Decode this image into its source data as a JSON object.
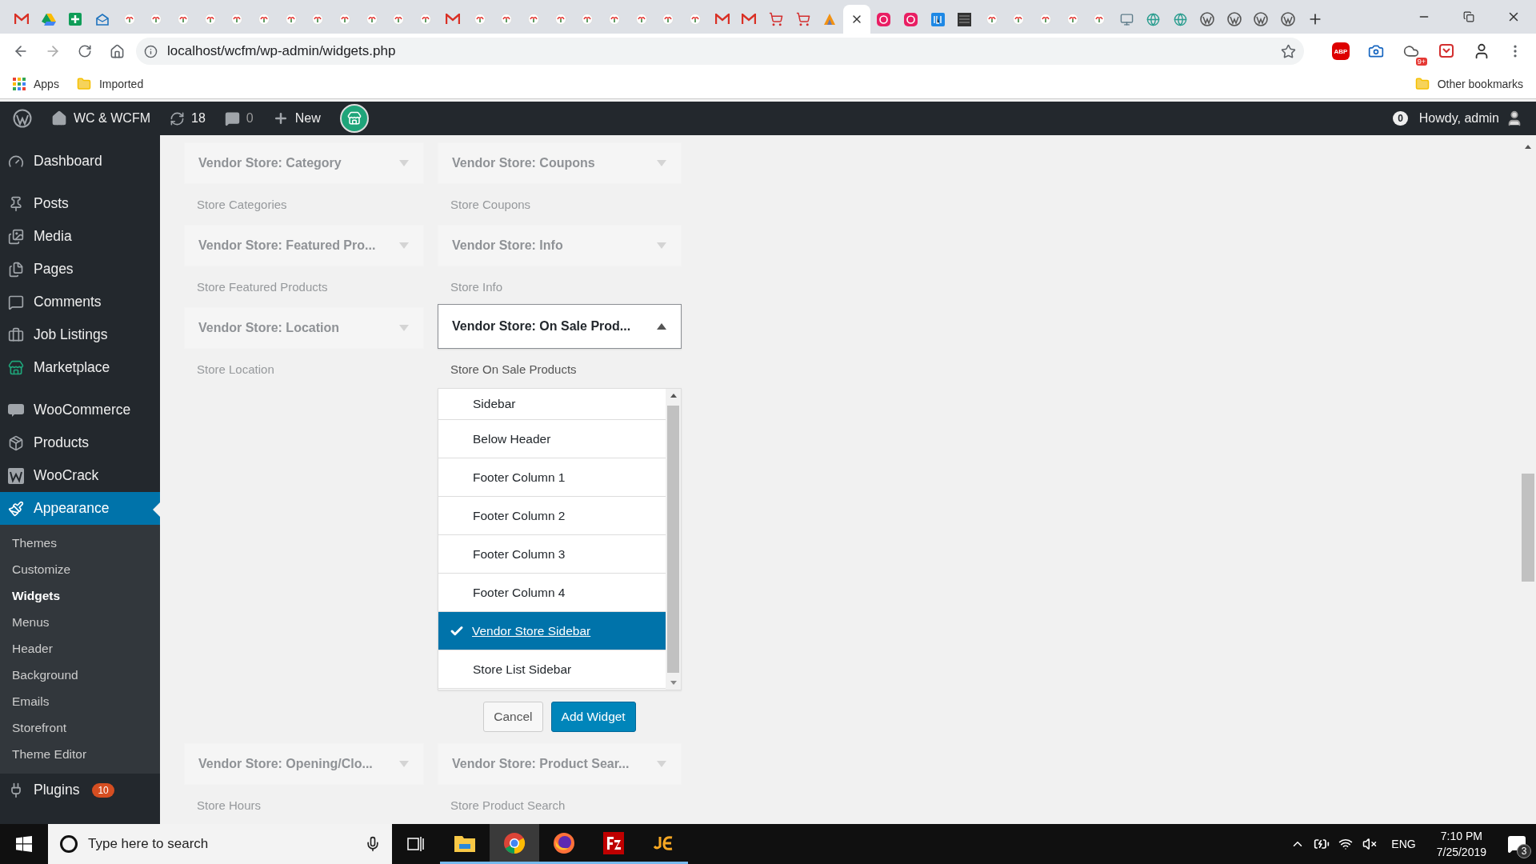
{
  "browser": {
    "tabs": [
      {
        "kind": "gmail",
        "selected": false
      },
      {
        "kind": "drive",
        "selected": false
      },
      {
        "kind": "sheets",
        "selected": false
      },
      {
        "kind": "mail",
        "selected": false
      },
      {
        "kind": "site",
        "selected": false
      },
      {
        "kind": "site",
        "selected": false
      },
      {
        "kind": "site",
        "selected": false
      },
      {
        "kind": "site",
        "selected": false
      },
      {
        "kind": "site",
        "selected": false
      },
      {
        "kind": "site",
        "selected": false
      },
      {
        "kind": "site",
        "selected": false
      },
      {
        "kind": "site",
        "selected": false
      },
      {
        "kind": "site",
        "selected": false
      },
      {
        "kind": "site",
        "selected": false
      },
      {
        "kind": "site",
        "selected": false
      },
      {
        "kind": "site",
        "selected": false
      },
      {
        "kind": "gmail",
        "selected": false
      },
      {
        "kind": "site",
        "selected": false
      },
      {
        "kind": "site",
        "selected": false
      },
      {
        "kind": "site",
        "selected": false
      },
      {
        "kind": "site",
        "selected": false
      },
      {
        "kind": "site",
        "selected": false
      },
      {
        "kind": "site",
        "selected": false
      },
      {
        "kind": "site",
        "selected": false
      },
      {
        "kind": "site",
        "selected": false
      },
      {
        "kind": "site",
        "selected": false
      },
      {
        "kind": "gmail",
        "selected": false
      },
      {
        "kind": "gmail",
        "selected": false
      },
      {
        "kind": "cart",
        "selected": false
      },
      {
        "kind": "cart",
        "selected": false
      },
      {
        "kind": "pma",
        "selected": false
      },
      {
        "selected": true
      },
      {
        "kind": "pink",
        "selected": false
      },
      {
        "kind": "pink",
        "selected": false
      },
      {
        "kind": "ibb",
        "selected": false
      },
      {
        "kind": "dark",
        "selected": false
      },
      {
        "kind": "site",
        "selected": false
      },
      {
        "kind": "site",
        "selected": false
      },
      {
        "kind": "site",
        "selected": false
      },
      {
        "kind": "site",
        "selected": false
      },
      {
        "kind": "site",
        "selected": false
      },
      {
        "kind": "monitor",
        "selected": false
      },
      {
        "kind": "globe",
        "selected": false
      },
      {
        "kind": "globe",
        "selected": false
      },
      {
        "kind": "wp",
        "selected": false
      },
      {
        "kind": "wp",
        "selected": false
      },
      {
        "kind": "wp",
        "selected": false
      },
      {
        "kind": "wp",
        "selected": false
      }
    ],
    "url": "localhost/wcfm/wp-admin/widgets.php",
    "extensions": [
      {
        "kind": "abp",
        "label": "ABP"
      },
      {
        "kind": "camera"
      },
      {
        "kind": "cloud",
        "badge": "9+"
      },
      {
        "kind": "pocket"
      }
    ],
    "bookmarks": [
      {
        "kind": "apps",
        "label": "Apps"
      },
      {
        "kind": "folder",
        "label": "Imported"
      }
    ],
    "other_bookmarks": "Other bookmarks"
  },
  "admin_bar": {
    "site": "WC & WCFM",
    "updates": "18",
    "comments": "0",
    "new": "New",
    "notifications": "0",
    "greeting": "Howdy, admin"
  },
  "menu_groups": [
    [
      {
        "label": "Dashboard",
        "kind": "dashboard",
        "selected": false
      }
    ],
    [
      {
        "label": "Posts",
        "kind": "pin",
        "selected": false
      },
      {
        "label": "Media",
        "kind": "media",
        "selected": false
      },
      {
        "label": "Pages",
        "kind": "pages",
        "selected": false
      },
      {
        "label": "Comments",
        "kind": "comments",
        "selected": false
      },
      {
        "label": "Job Listings",
        "kind": "briefcase",
        "selected": false
      },
      {
        "label": "Marketplace",
        "kind": "store",
        "selected": false
      }
    ],
    [
      {
        "label": "WooCommerce",
        "kind": "woo",
        "selected": false
      },
      {
        "label": "Products",
        "kind": "box",
        "selected": false
      },
      {
        "label": "WooCrack",
        "kind": "w",
        "selected": false
      },
      {
        "label": "Appearance",
        "kind": "brush",
        "selected": true,
        "submenu": [
          {
            "label": "Themes",
            "selected": false
          },
          {
            "label": "Customize",
            "selected": false
          },
          {
            "label": "Widgets",
            "selected": true
          },
          {
            "label": "Menus",
            "selected": false
          },
          {
            "label": "Header",
            "selected": false
          },
          {
            "label": "Background",
            "selected": false
          },
          {
            "label": "Emails",
            "selected": false
          },
          {
            "label": "Storefront",
            "selected": false
          },
          {
            "label": "Theme Editor",
            "selected": false
          }
        ]
      },
      {
        "label": "Plugins",
        "kind": "plug",
        "selected": false,
        "badge": "10"
      }
    ]
  ],
  "widgets": [
    {
      "title": "Vendor Store: Category",
      "description": "Store Categories",
      "expanded": false
    },
    {
      "title": "Vendor Store: Coupons",
      "description": "Store Coupons",
      "expanded": false
    },
    {
      "title": "Vendor Store: Featured Pro...",
      "description": "Store Featured Products",
      "expanded": false
    },
    {
      "title": "Vendor Store: Info",
      "description": "Store Info",
      "expanded": false
    },
    {
      "title": "Vendor Store: Location",
      "description": "Store Location",
      "expanded": false
    },
    {
      "title": "Vendor Store: On Sale Prod...",
      "description": "Store On Sale Products",
      "expanded": true
    },
    {
      "title": "Vendor Store: Opening/Clo...",
      "description": "Store Hours",
      "expanded": false
    },
    {
      "title": "Vendor Store: Product Sear...",
      "description": "Store Product Search",
      "expanded": false
    }
  ],
  "chooser": {
    "areas": [
      {
        "label": "Sidebar",
        "selected": false
      },
      {
        "label": "Below Header",
        "selected": false
      },
      {
        "label": "Footer Column 1",
        "selected": false
      },
      {
        "label": "Footer Column 2",
        "selected": false
      },
      {
        "label": "Footer Column 3",
        "selected": false
      },
      {
        "label": "Footer Column 4",
        "selected": false
      },
      {
        "label": "Vendor Store Sidebar",
        "selected": true
      },
      {
        "label": "Store List Sidebar",
        "selected": false
      }
    ],
    "cancel": "Cancel",
    "add": "Add Widget"
  },
  "taskbar": {
    "search_placeholder": "Type here to search",
    "apps": [
      {
        "kind": "explorer",
        "selected": false
      },
      {
        "kind": "chrome",
        "selected": true
      },
      {
        "kind": "firefox",
        "selected": false
      },
      {
        "kind": "filezilla",
        "selected": false
      },
      {
        "kind": "jetbrains",
        "selected": false
      }
    ],
    "language": "ENG",
    "time": "7:10 PM",
    "date": "7/25/2019",
    "notifications": "3"
  }
}
